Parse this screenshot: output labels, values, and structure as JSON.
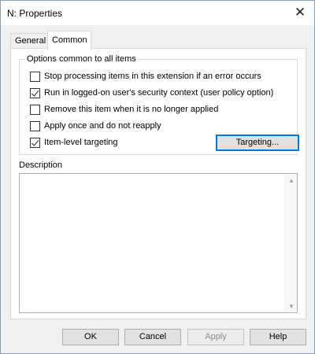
{
  "window": {
    "title": "N: Properties"
  },
  "tabs": [
    {
      "label": "General"
    },
    {
      "label": "Common"
    }
  ],
  "options_group": {
    "legend": "Options common to all items",
    "items": [
      {
        "label": "Stop processing items in this extension if an error occurs",
        "checked": false
      },
      {
        "label": "Run in logged-on user's security context (user policy option)",
        "checked": true
      },
      {
        "label": "Remove this item when it is no longer applied",
        "checked": false
      },
      {
        "label": "Apply once and do not reapply",
        "checked": false
      },
      {
        "label": "Item-level targeting",
        "checked": true
      }
    ],
    "targeting_button": "Targeting..."
  },
  "description": {
    "label": "Description",
    "value": ""
  },
  "buttons": {
    "ok": "OK",
    "cancel": "Cancel",
    "apply": "Apply",
    "help": "Help"
  }
}
